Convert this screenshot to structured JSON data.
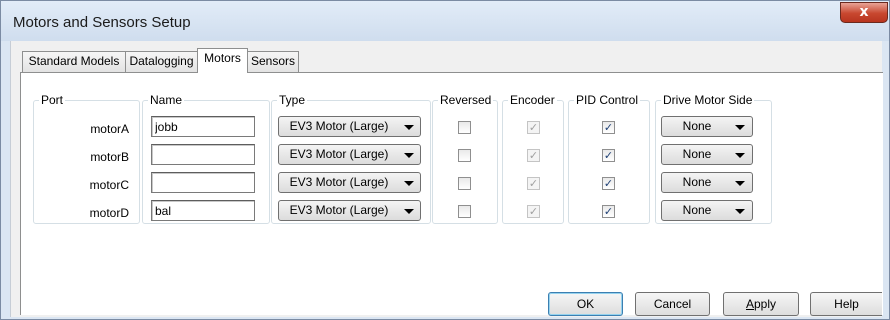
{
  "window": {
    "title": "Motors and Sensors Setup",
    "close_glyph": "x"
  },
  "tabs": [
    {
      "label": "Standard Models"
    },
    {
      "label": "Datalogging"
    },
    {
      "label": "Motors",
      "active": true
    },
    {
      "label": "Sensors"
    }
  ],
  "groups": {
    "port": "Port",
    "name": "Name",
    "type": "Type",
    "reversed": "Reversed",
    "encoder": "Encoder",
    "pid": "PID Control",
    "drive_side": "Drive Motor Side"
  },
  "motors": [
    {
      "port": "motorA",
      "name": "jobb",
      "type": "EV3 Motor (Large)",
      "reversed": false,
      "encoder": true,
      "pid": true,
      "drive_side": "None"
    },
    {
      "port": "motorB",
      "name": "",
      "type": "EV3 Motor (Large)",
      "reversed": false,
      "encoder": true,
      "pid": true,
      "drive_side": "None"
    },
    {
      "port": "motorC",
      "name": "",
      "type": "EV3 Motor (Large)",
      "reversed": false,
      "encoder": true,
      "pid": true,
      "drive_side": "None"
    },
    {
      "port": "motorD",
      "name": "bal",
      "type": "EV3 Motor (Large)",
      "reversed": false,
      "encoder": true,
      "pid": true,
      "drive_side": "None"
    }
  ],
  "checkmark_glyph": "✓",
  "buttons": {
    "ok": "OK",
    "cancel": "Cancel",
    "apply_mnemonic": "A",
    "apply_rest": "pply",
    "help": "Help"
  },
  "colors": {
    "title_bar": "#dbe6f3",
    "close_button": "#c8472f",
    "default_button_border": "#3c7fb1"
  }
}
